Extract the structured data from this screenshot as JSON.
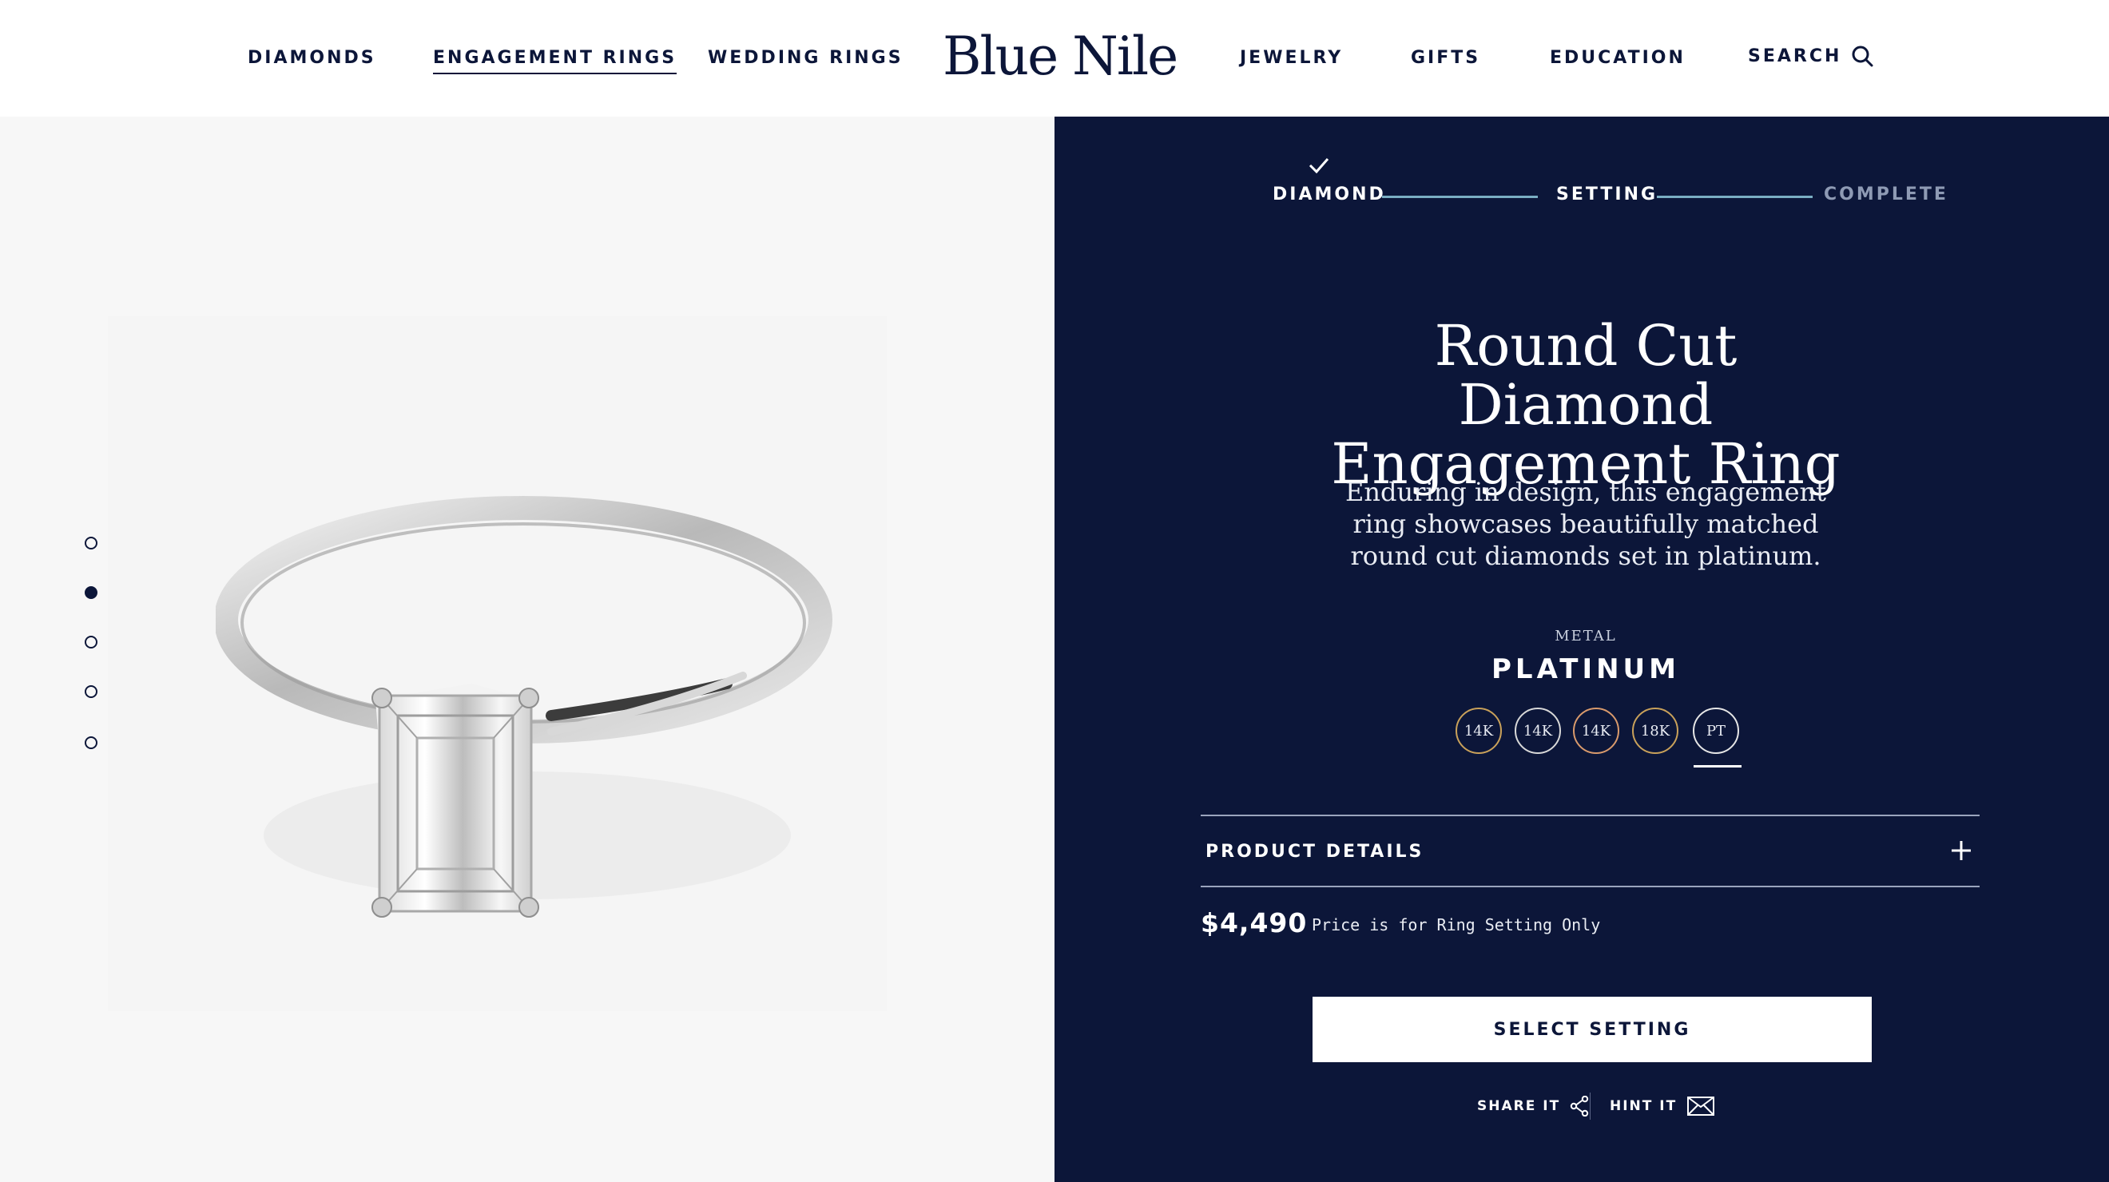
{
  "header": {
    "nav_left": [
      "DIAMONDS",
      "ENGAGEMENT RINGS",
      "WEDDING RINGS"
    ],
    "logo": "Blue Nile",
    "nav_right": [
      "JEWELRY",
      "GIFTS",
      "EDUCATION"
    ],
    "search_label": "SEARCH",
    "active_item": "ENGAGEMENT RINGS"
  },
  "gallery": {
    "image_count": 5,
    "active_index": 2
  },
  "steps": {
    "items": [
      "DIAMOND",
      "SETTING",
      "COMPLETE"
    ],
    "completed": "DIAMOND",
    "current": "SETTING"
  },
  "product": {
    "title": "Round Cut Diamond Engagement Ring",
    "description": "Enduring in design, this engagement ring showcases beautifully matched round cut diamonds set in platinum.",
    "metal_label": "METAL",
    "metal_value": "PLATINUM",
    "metal_options": [
      "14K",
      "14K",
      "14K",
      "18K",
      "PT"
    ],
    "selected_metal": "PT",
    "details_label": "PRODUCT DETAILS",
    "price": "$4,490",
    "price_note": "Price is for Ring Setting Only",
    "cta": "SELECT SETTING",
    "share_label": "SHARE IT",
    "hint_label": "HINT IT"
  },
  "colors": {
    "navy": "#0c1639",
    "accent_line": "#7aaec3",
    "gold": "#c9a15a",
    "gallery_bg": "#f7f7f7"
  }
}
